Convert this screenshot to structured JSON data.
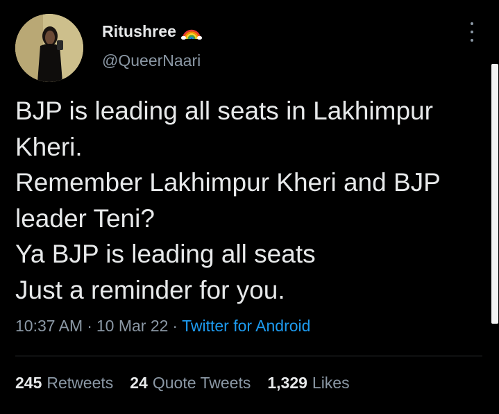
{
  "author": {
    "display_name": "Ritushree",
    "badge_icon": "rainbow-icon",
    "handle": "@QueerNaari"
  },
  "tweet": {
    "lines": [
      "BJP is leading all seats in Lakhimpur",
      "Kheri.",
      "Remember Lakhimpur Kheri and BJP",
      "leader Teni?",
      "Ya BJP is leading all seats",
      "Just a reminder for you."
    ]
  },
  "meta": {
    "time": "10:37 AM",
    "separator": "·",
    "date": "10 Mar 22",
    "source": "Twitter for Android"
  },
  "stats": {
    "retweets_count": "245",
    "retweets_label": "Retweets",
    "quotes_count": "24",
    "quotes_label": "Quote Tweets",
    "likes_count": "1,329",
    "likes_label": "Likes"
  },
  "colors": {
    "background": "#000000",
    "text": "#e7e9ea",
    "secondary": "#8b98a5",
    "link": "#1d9bf0",
    "divider": "#2f3336"
  }
}
